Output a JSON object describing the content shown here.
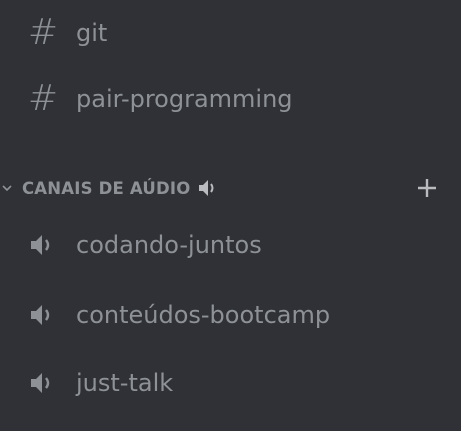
{
  "text_channels": [
    {
      "icon": "hash-icon",
      "symbol": "#",
      "label": "git"
    },
    {
      "icon": "hash-icon",
      "symbol": "#",
      "label": "pair-programming"
    }
  ],
  "voice_category": {
    "label": "CANAIS DE AÚDIO",
    "label_icon": "speaker-icon",
    "collapse_icon": "chevron-down-icon",
    "add_icon": "plus-icon"
  },
  "voice_channels": [
    {
      "icon": "speaker-icon",
      "label": "codando-juntos"
    },
    {
      "icon": "speaker-icon",
      "label": "conteúdos-bootcamp"
    },
    {
      "icon": "speaker-icon",
      "label": "just-talk"
    }
  ],
  "colors": {
    "background": "#2f3136",
    "text_muted": "#8e9297",
    "icon": "#b9bbbe"
  }
}
